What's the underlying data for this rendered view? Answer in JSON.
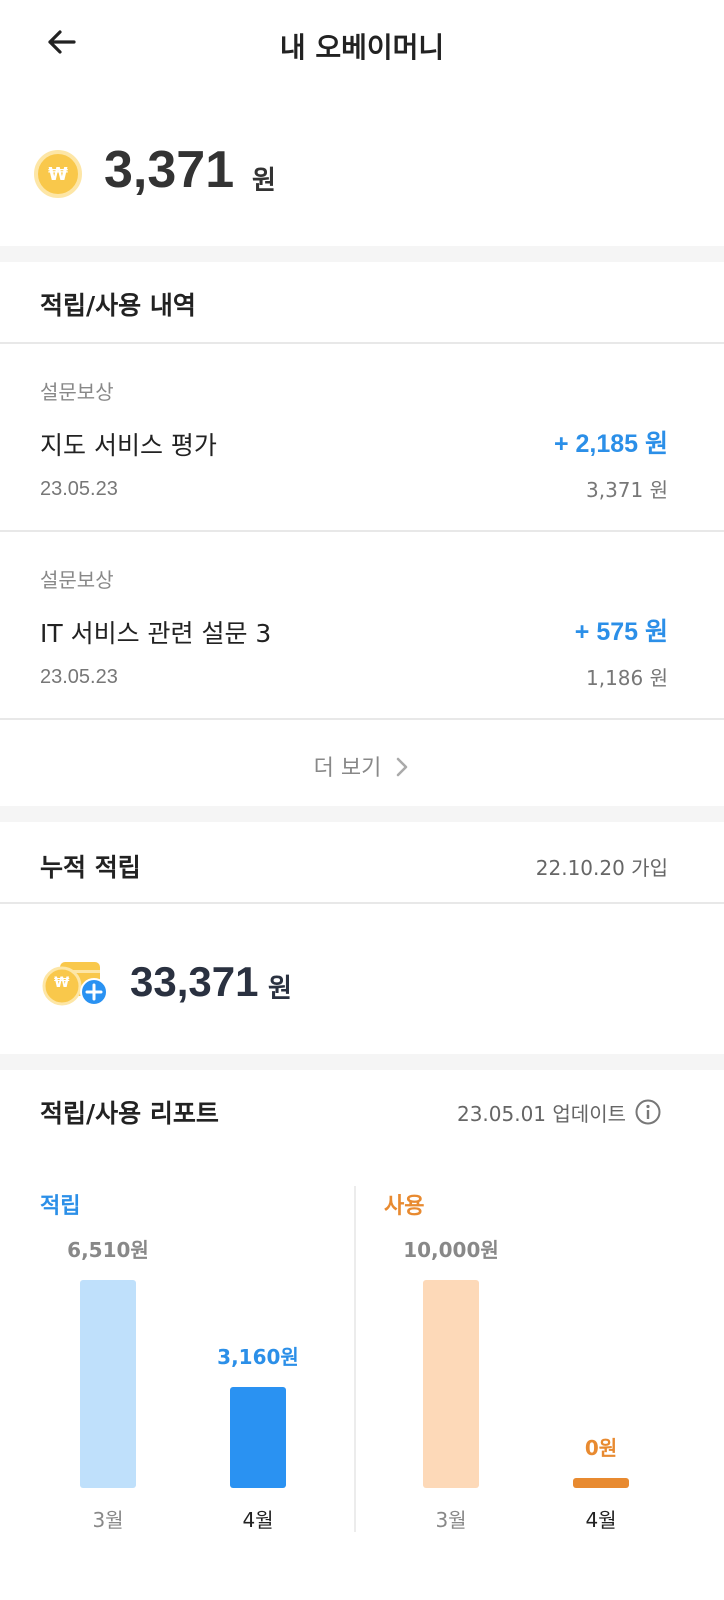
{
  "header": {
    "title": "내 오베이머니"
  },
  "balance": {
    "currency_symbol": "₩",
    "amount": "3,371",
    "unit": "원"
  },
  "history": {
    "title": "적립/사용 내역",
    "items": [
      {
        "category": "설문보상",
        "title": "지도 서비스 평가",
        "date": "23.05.23",
        "amount": "+ 2,185 원",
        "balance": "3,371 원"
      },
      {
        "category": "설문보상",
        "title": "IT 서비스 관련 설문 3",
        "date": "23.05.23",
        "amount": "+ 575 원",
        "balance": "1,186 원"
      }
    ],
    "more_label": "더 보기"
  },
  "cumulative": {
    "title": "누적 적립",
    "joined": "22.10.20 가입",
    "currency_symbol": "₩",
    "amount": "33,371",
    "unit": "원"
  },
  "report": {
    "title": "적립/사용 리포트",
    "updated": "23.05.01 업데이트",
    "earn": {
      "label": "적립",
      "color": "#2b8fe8",
      "months": [
        {
          "month": "3월",
          "value_label": "6,510원",
          "value": 6510,
          "color": "#bfe0fb"
        },
        {
          "month": "4월",
          "value_label": "3,160원",
          "value": 3160,
          "color": "#2a92f2"
        }
      ]
    },
    "spend": {
      "label": "사용",
      "color": "#e88a30",
      "months": [
        {
          "month": "3월",
          "value_label": "10,000원",
          "value": 10000,
          "color": "#fdd9b8"
        },
        {
          "month": "4월",
          "value_label": "0원",
          "value": 0,
          "color": "#e88a30"
        }
      ]
    }
  },
  "colors": {
    "accent_blue": "#2b8fe8",
    "accent_orange": "#e88a30",
    "coin_yellow": "#f9c84b"
  }
}
